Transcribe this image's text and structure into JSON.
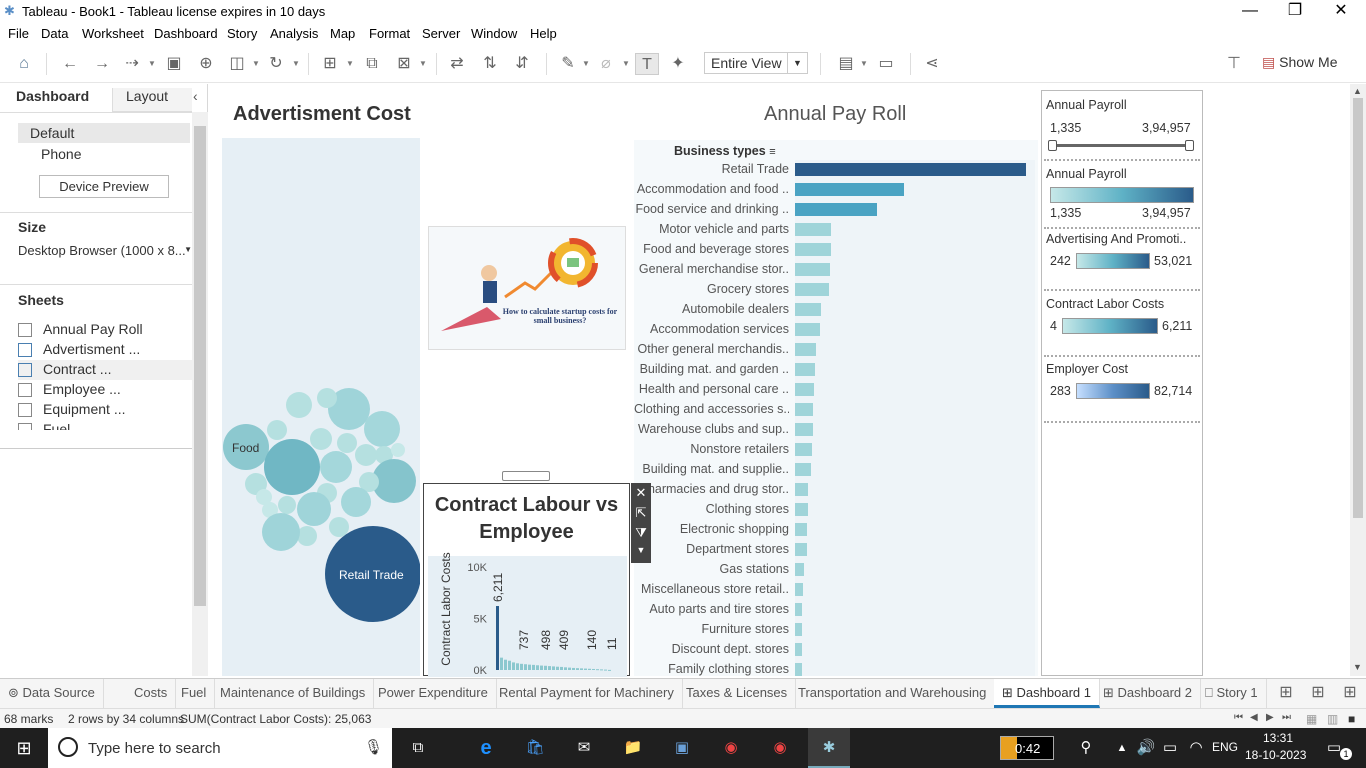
{
  "window": {
    "title": "Tableau - Book1 - Tableau license expires in 10 days"
  },
  "menu": [
    "File",
    "Data",
    "Worksheet",
    "Dashboard",
    "Story",
    "Analysis",
    "Map",
    "Format",
    "Server",
    "Window",
    "Help"
  ],
  "toolbar": {
    "view_select": "Entire View",
    "show_me": "Show Me"
  },
  "left_pane": {
    "tabs": [
      "Dashboard",
      "Layout"
    ],
    "device_options": [
      "Default",
      "Phone"
    ],
    "device_preview_button": "Device Preview",
    "size_heading": "Size",
    "size_value": "Desktop Browser (1000 x 8...",
    "sheets_heading": "Sheets",
    "sheets": [
      "Annual Pay Roll",
      "Advertisment ...",
      "Contract ...",
      "Employee ...",
      "Equipment ...",
      "Fuel"
    ]
  },
  "dashboard": {
    "advertisment_title": "Advertisment Cost",
    "bubble_labels": [
      "Food",
      "Retail Trade"
    ],
    "image_caption": "How to calculate startup costs for small business?",
    "payroll_title": "Annual Pay Roll",
    "bar_header": "Business types"
  },
  "chart_data": [
    {
      "type": "bar",
      "orientation": "horizontal",
      "title": "Annual Pay Roll",
      "categories": [
        "Retail Trade",
        "Accommodation and food ..",
        "Food service and drinking ..",
        "Motor vehicle and parts",
        "Food and beverage stores",
        "General merchandise stor..",
        "Grocery stores",
        "Automobile dealers",
        "Accommodation services",
        "Other general merchandis..",
        "Building mat. and garden ..",
        "Health and personal care ..",
        "Clothing and accessories s..",
        "Warehouse clubs and sup..",
        "Nonstore retailers",
        "Building mat. and supplie..",
        "Pharmacies and drug stor..",
        "Clothing stores",
        "Electronic shopping",
        "Department stores",
        "Gas stations",
        "Miscellaneous store retail..",
        "Auto parts and tire stores",
        "Furniture stores",
        "Discount dept. stores",
        "Family clothing stores"
      ],
      "values": [
        394957,
        186000,
        141000,
        62000,
        62000,
        59000,
        58000,
        45000,
        42000,
        36000,
        34000,
        32000,
        31000,
        30000,
        29000,
        28000,
        23000,
        22000,
        21000,
        21000,
        15000,
        13000,
        12000,
        12000,
        12000,
        12000
      ],
      "ylabel": "Business types"
    },
    {
      "type": "bar",
      "title": "Contract Labour vs Employee",
      "ylabel": "Contract Labor Costs",
      "y_ticks": [
        "10K",
        "5K",
        "0K"
      ],
      "ylim": [
        0,
        10000
      ],
      "values": [
        6211,
        1200,
        1000,
        900,
        737,
        650,
        600,
        560,
        520,
        498,
        460,
        430,
        409,
        380,
        350,
        320,
        300,
        260,
        230,
        200,
        180,
        160,
        140,
        120,
        100,
        80,
        60,
        40,
        11
      ],
      "data_labels": [
        "6,211",
        "737",
        "498",
        "409",
        "140",
        "11"
      ],
      "data_label_values": [
        6211,
        737,
        498,
        409,
        140,
        11
      ]
    }
  ],
  "legends": [
    {
      "title": "Annual Payroll",
      "type": "range-slider",
      "min": "1,335",
      "max": "3,94,957"
    },
    {
      "title": "Annual Payroll",
      "type": "color",
      "min": "1,335",
      "max": "3,94,957",
      "colors": [
        "#c6e8e8",
        "#2a5b8a"
      ]
    },
    {
      "title": "Advertising And Promoti..",
      "type": "color",
      "min": "242",
      "max": "53,021",
      "colors": [
        "#c6e8e8",
        "#2a5b8a"
      ]
    },
    {
      "title": "Contract Labor Costs",
      "type": "color",
      "min": "4",
      "max": "6,211",
      "colors": [
        "#c6e8e8",
        "#2a5b8a"
      ]
    },
    {
      "title": "Employer Cost",
      "type": "color",
      "min": "283",
      "max": "82,714",
      "colors": [
        "#c6dfff",
        "#2a5b8a"
      ]
    }
  ],
  "bottom_tabs": [
    "Data Source",
    "Costs",
    "Fuel",
    "Maintenance of Buildings",
    "Power Expenditure",
    "Rental Payment for Machinery",
    "Taxes & Licenses",
    "Transportation and Warehousing",
    "Dashboard 1",
    "Dashboard 2",
    "Story 1"
  ],
  "active_tab": "Dashboard 1",
  "status": {
    "marks": "68 marks",
    "rows_cols": "2 rows by 34 columns",
    "sum": "SUM(Contract Labor Costs): 25,063"
  },
  "taskbar": {
    "search_placeholder": "Type here to search",
    "battery_time": "0:42",
    "language": "ENG",
    "time": "13:31",
    "date": "18-10-2023",
    "notification_count": "1"
  },
  "colors": {
    "bar_dark": "#2a5b8a",
    "bar_mid": "#4aa3c3",
    "bar_light": "#9fd4d9",
    "panel_bg": "#e6eff5"
  }
}
